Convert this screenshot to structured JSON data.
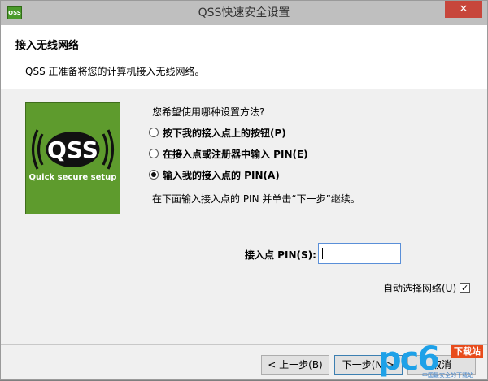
{
  "window": {
    "title": "QSS快速安全设置",
    "app_icon": "QSS",
    "close_symbol": "✕"
  },
  "header": {
    "heading": "接入无线网络",
    "subheading": "QSS 正准备将您的计算机接入无线网络。"
  },
  "logo": {
    "text": "QSS",
    "caption": "Quick secure setup",
    "bg_color": "#5e9b2d"
  },
  "form": {
    "question": "您希望使用哪种设置方法?",
    "options": [
      {
        "label": "按下我的接入点上的按钮(P)",
        "checked": false
      },
      {
        "label": "在接入点或注册器中输入 PIN(E)",
        "checked": false
      },
      {
        "label": "输入我的接入点的 PIN(A)",
        "checked": true
      }
    ],
    "hint": "在下面输入接入点的 PIN 并单击“下一步”继续。",
    "pin_label": "接入点 PIN(S):",
    "pin_value": "",
    "auto_select_label": "自动选择网络(U)",
    "auto_select_checked": "✓"
  },
  "buttons": {
    "back": "< 上一步(B)",
    "next": "下一步(N)>",
    "cancel": "取消"
  },
  "watermark": {
    "brand": "pc6",
    "badge": "下载站",
    "sub": "中国最安全的下载站"
  }
}
